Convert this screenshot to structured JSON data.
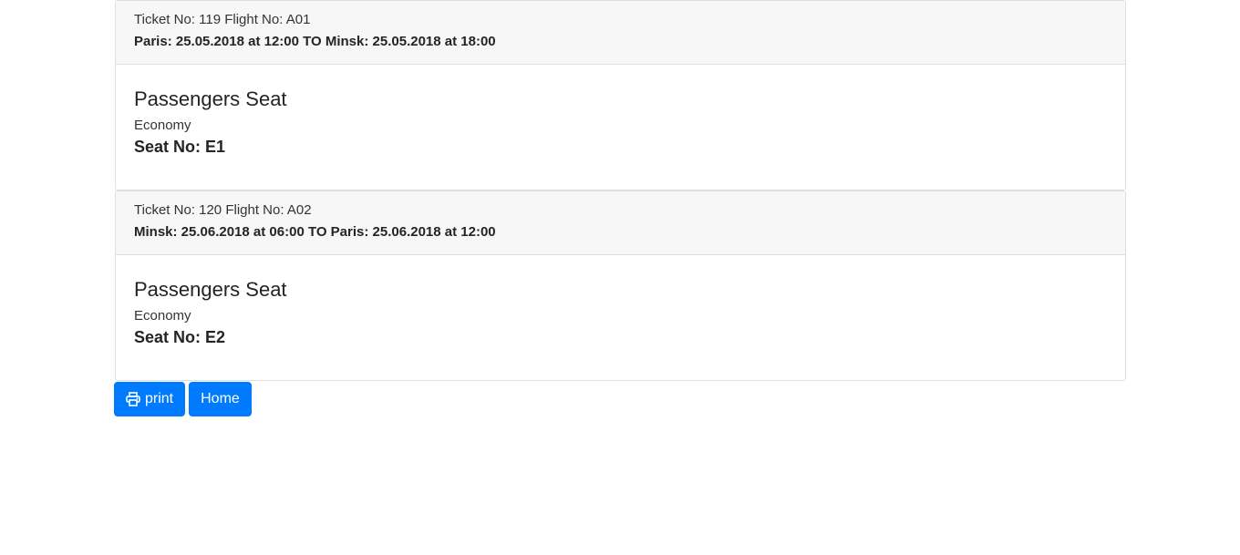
{
  "tickets": [
    {
      "ticket_line": "Ticket No: 119 Flight No: A01",
      "route": "Paris: 25.05.2018 at 12:00 TO Minsk: 25.05.2018 at 18:00",
      "seat_title": "Passengers Seat",
      "seat_class": "Economy",
      "seat_no": "Seat No: E1"
    },
    {
      "ticket_line": "Ticket No: 120 Flight No: A02",
      "route": "Minsk: 25.06.2018 at 06:00 TO Paris: 25.06.2018 at 12:00",
      "seat_title": "Passengers Seat",
      "seat_class": "Economy",
      "seat_no": "Seat No: E2"
    }
  ],
  "actions": {
    "print_label": "print",
    "print_icon": "printer-icon",
    "home_label": "Home"
  },
  "colors": {
    "primary": "#007bff",
    "header_bg": "#f7f7f7"
  }
}
